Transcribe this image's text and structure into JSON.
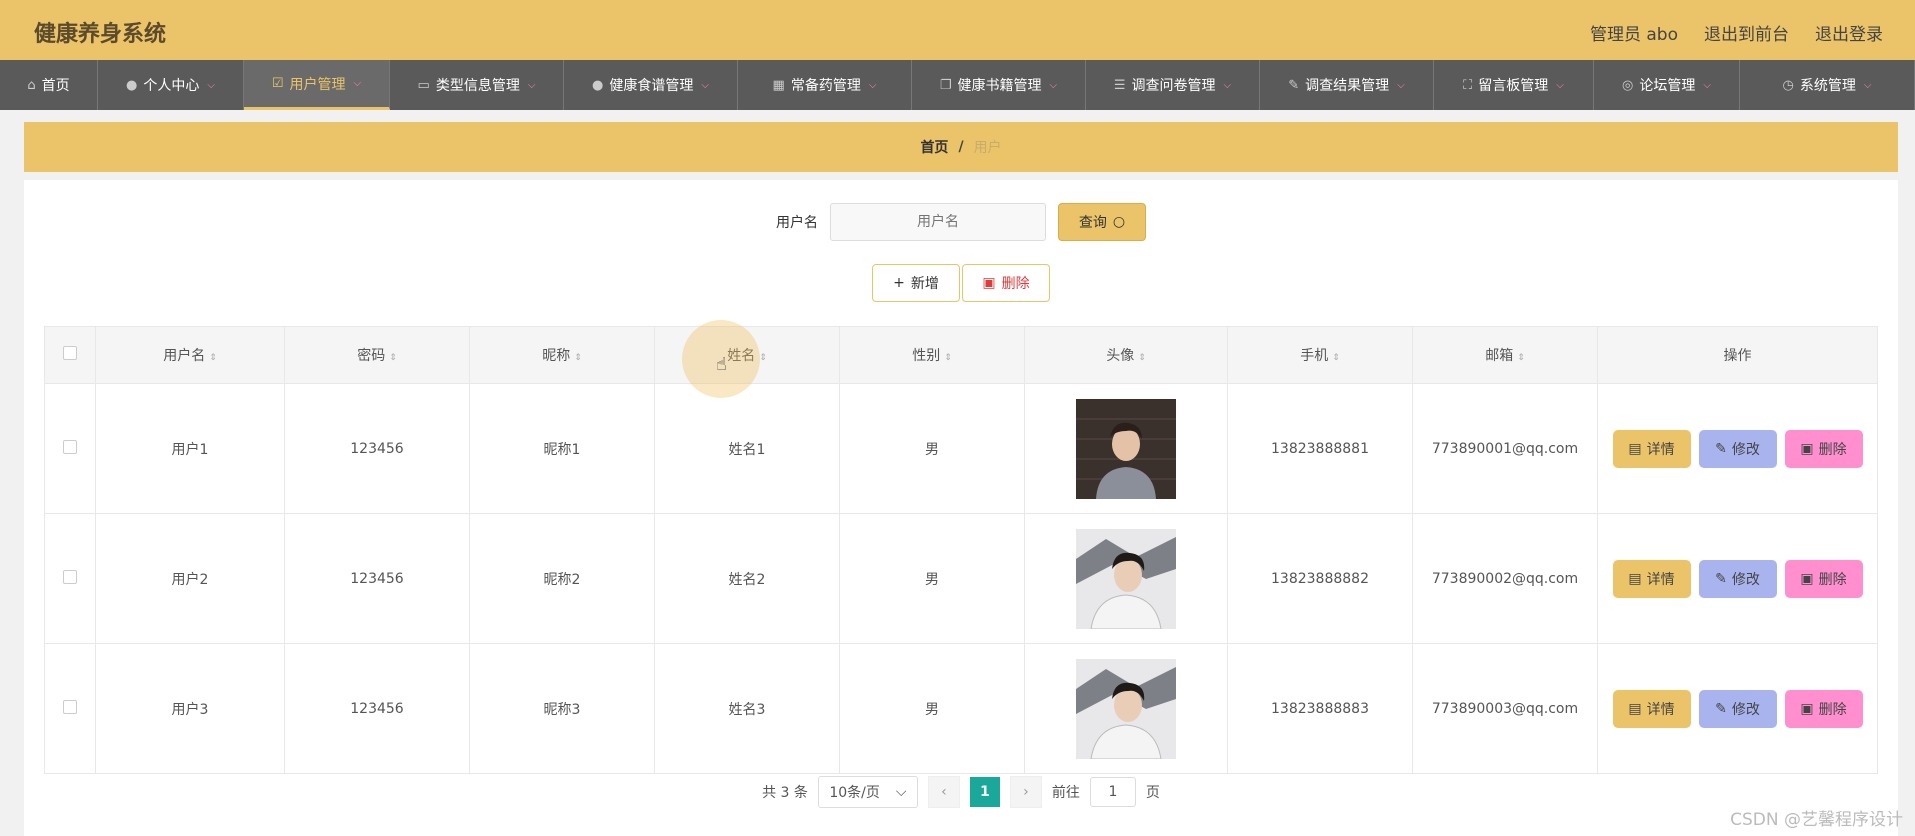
{
  "header": {
    "title": "健康养身系统",
    "admin": "管理员 abo",
    "front": "退出到前台",
    "logout": "退出登录"
  },
  "nav": [
    {
      "label": "首页",
      "icon": "home-icon",
      "glyph": "⌂"
    },
    {
      "label": "个人中心",
      "icon": "user-icon",
      "glyph": "●"
    },
    {
      "label": "用户管理",
      "icon": "edit-icon",
      "glyph": "☑"
    },
    {
      "label": "类型信息管理",
      "icon": "card-icon",
      "glyph": "▭"
    },
    {
      "label": "健康食谱管理",
      "icon": "person-icon",
      "glyph": "●"
    },
    {
      "label": "常备药管理",
      "icon": "grid-icon",
      "glyph": "▦"
    },
    {
      "label": "健康书籍管理",
      "icon": "copy-icon",
      "glyph": "❐"
    },
    {
      "label": "调查问卷管理",
      "icon": "list-icon",
      "glyph": "☰"
    },
    {
      "label": "调查结果管理",
      "icon": "pen-icon",
      "glyph": "✎"
    },
    {
      "label": "留言板管理",
      "icon": "expand-icon",
      "glyph": "⛶"
    },
    {
      "label": "论坛管理",
      "icon": "forum-icon",
      "glyph": "◎"
    },
    {
      "label": "系统管理",
      "icon": "clock-icon",
      "glyph": "◷"
    }
  ],
  "breadcrumb": {
    "home": "首页",
    "sep": "/",
    "current": "用户"
  },
  "search": {
    "label": "用户名",
    "placeholder": "用户名",
    "button": "查询"
  },
  "toolbar": {
    "add": "新增",
    "delete": "删除"
  },
  "table": {
    "headers": [
      "用户名",
      "密码",
      "昵称",
      "姓名",
      "性别",
      "头像",
      "手机",
      "邮箱",
      "操作"
    ],
    "rows": [
      {
        "username": "用户1",
        "password": "123456",
        "nickname": "昵称1",
        "name": "姓名1",
        "gender": "男",
        "phone": "13823888881",
        "email": "773890001@qq.com"
      },
      {
        "username": "用户2",
        "password": "123456",
        "nickname": "昵称2",
        "name": "姓名2",
        "gender": "男",
        "phone": "13823888882",
        "email": "773890002@qq.com"
      },
      {
        "username": "用户3",
        "password": "123456",
        "nickname": "昵称3",
        "name": "姓名3",
        "gender": "男",
        "phone": "13823888883",
        "email": "773890003@qq.com"
      }
    ],
    "row_buttons": {
      "detail": "详情",
      "edit": "修改",
      "delete": "删除"
    }
  },
  "pagination": {
    "total": "共 3 条",
    "page_size": "10条/页",
    "current_page": "1",
    "goto_label": "前往",
    "goto_value": "1",
    "page_suffix": "页"
  },
  "watermark": "CSDN @艺馨程序设计",
  "colors": {
    "accent": "#ebc46a",
    "nav_bg": "#5a5a5a",
    "edit": "#a9b3ee",
    "delete": "#ff8fcf",
    "page_active": "#1aa89b"
  }
}
